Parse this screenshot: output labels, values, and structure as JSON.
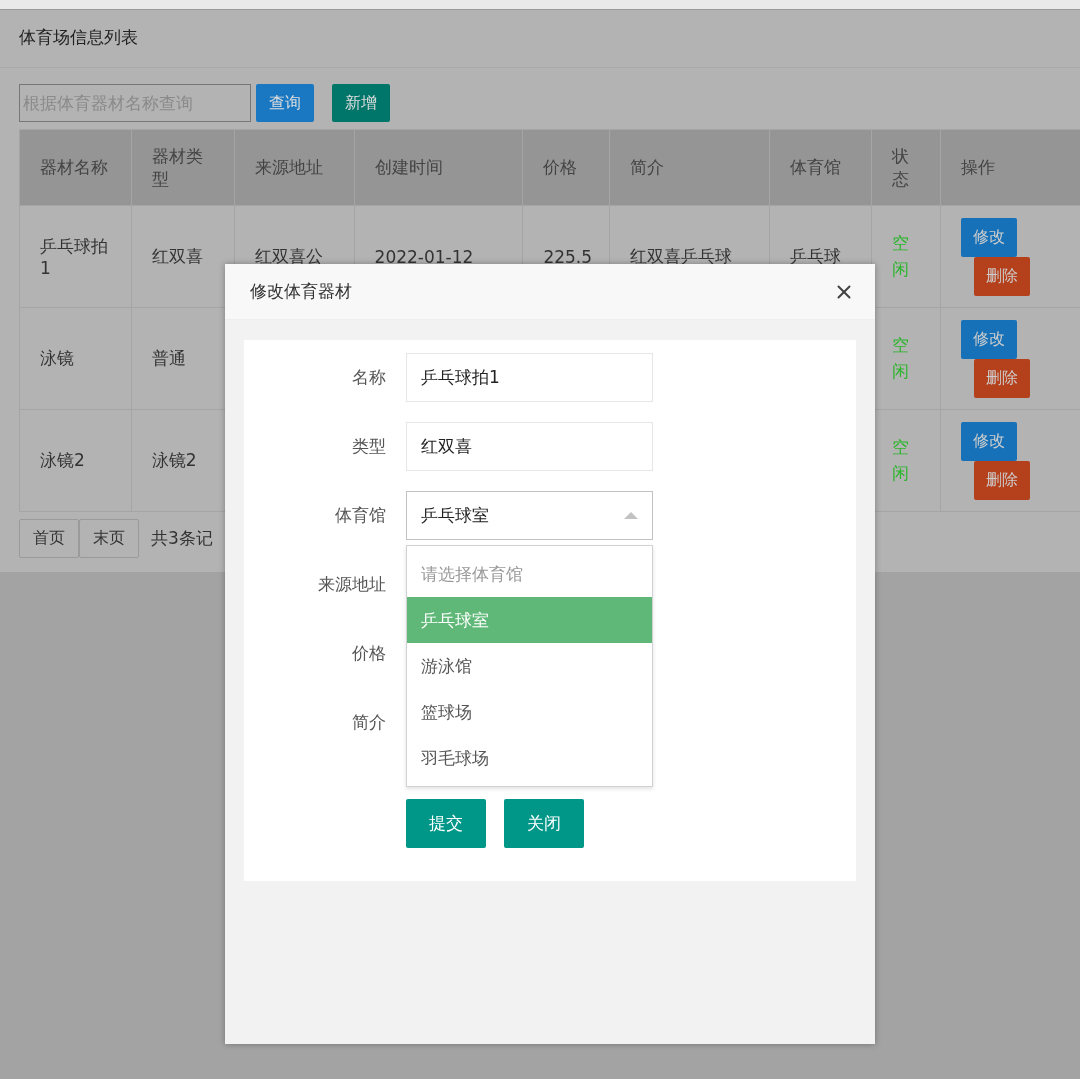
{
  "page": {
    "title": "体育场信息列表"
  },
  "search": {
    "placeholder": "根据体育器材名称查询"
  },
  "toolbar_buttons": [
    {
      "label": "查询",
      "kind": "query"
    },
    {
      "label": "新增",
      "kind": "add"
    }
  ],
  "table": {
    "columns": [
      "器材名称",
      "器材类型",
      "来源地址",
      "创建时间",
      "价格",
      "简介",
      "体育馆",
      "状态",
      "操作"
    ],
    "rows": [
      {
        "cells": [
          "乒乓球拍1",
          "红双喜",
          "红双喜公",
          "2022-01-12",
          "225.5",
          "红双喜乒乓球",
          "乒乓球"
        ],
        "status": "空闲",
        "actions": [
          {
            "label": "修改",
            "kind": "edit"
          },
          {
            "label": "删除",
            "kind": "delete"
          }
        ]
      },
      {
        "cells": [
          "泳镜",
          "普通"
        ],
        "status": "空闲",
        "actions": [
          {
            "label": "修改",
            "kind": "edit"
          },
          {
            "label": "删除",
            "kind": "delete"
          }
        ]
      },
      {
        "cells": [
          "泳镜2",
          "泳镜2"
        ],
        "status": "空闲",
        "actions": [
          {
            "label": "修改",
            "kind": "edit"
          },
          {
            "label": "删除",
            "kind": "delete"
          }
        ]
      }
    ]
  },
  "pagination": {
    "buttons": [
      "首页",
      "末页"
    ],
    "summary": "共3条记"
  },
  "modal": {
    "title": "修改体育器材",
    "fields": [
      {
        "label": "名称",
        "kind": "text",
        "value": "乒乓球拍1"
      },
      {
        "label": "类型",
        "kind": "text",
        "value": "红双喜"
      },
      {
        "label": "体育馆",
        "kind": "select",
        "value": "乒乓球室",
        "expanded": true,
        "options": [
          {
            "label": "请选择体育馆",
            "kind": "placeholder",
            "selected": false
          },
          {
            "label": "乒乓球室",
            "kind": "option",
            "selected": true
          },
          {
            "label": "游泳馆",
            "kind": "option",
            "selected": false
          },
          {
            "label": "篮球场",
            "kind": "option",
            "selected": false
          },
          {
            "label": "羽毛球场",
            "kind": "option",
            "selected": false
          }
        ]
      },
      {
        "label": "来源地址",
        "kind": "covered"
      },
      {
        "label": "价格",
        "kind": "covered"
      },
      {
        "label": "简介",
        "kind": "covered"
      }
    ],
    "buttons": [
      "提交",
      "关闭"
    ]
  }
}
